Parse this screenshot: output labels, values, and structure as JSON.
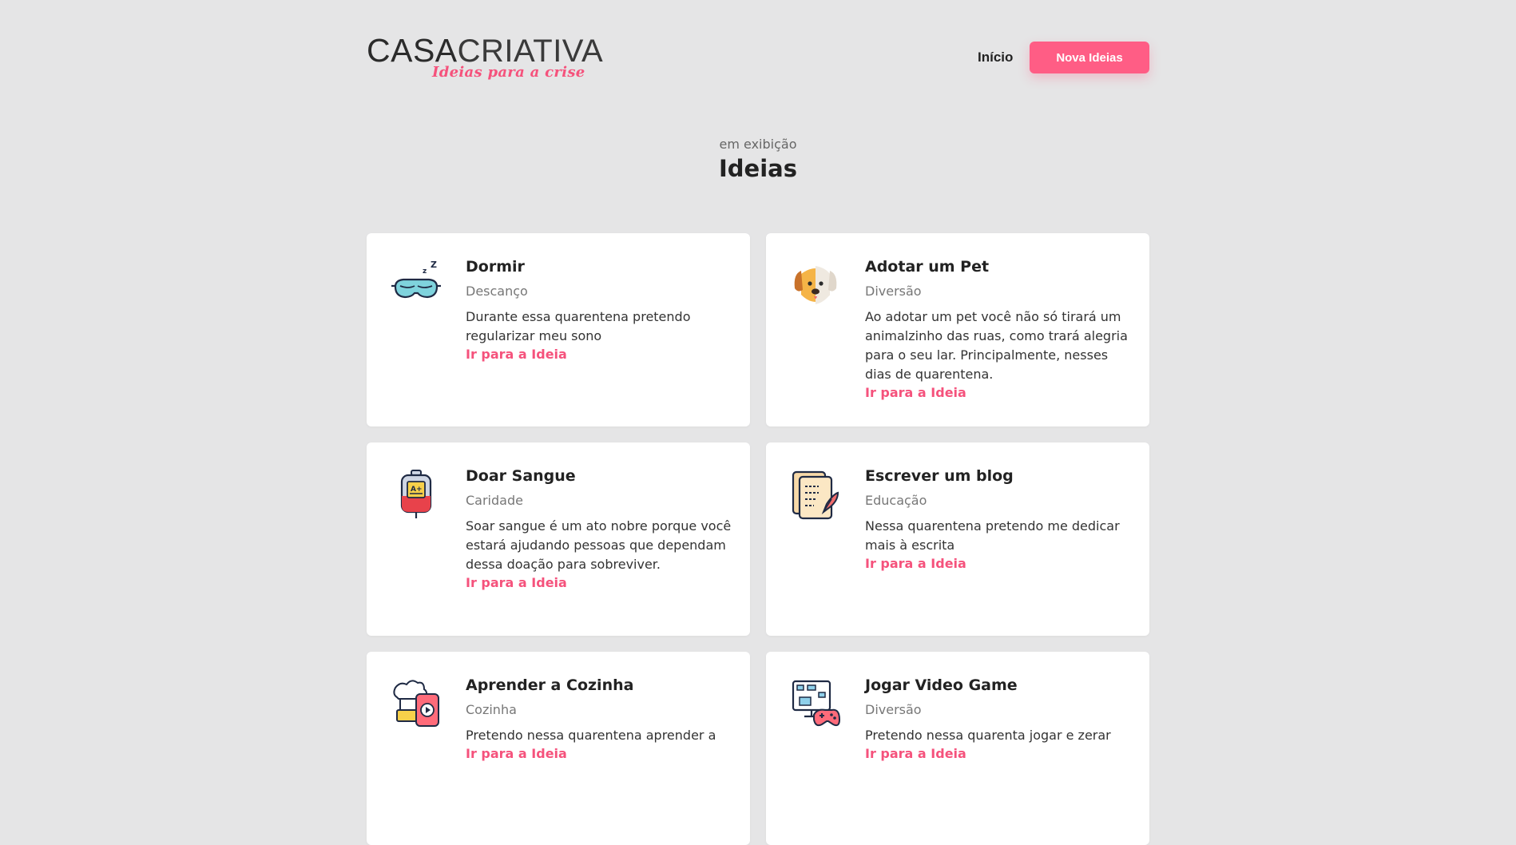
{
  "header": {
    "logo": {
      "part1": "CASA",
      "part2": "CRIATIVA",
      "tagline": "Ideias para a crise"
    },
    "nav_home": "Início",
    "cta_label": "Nova Ideias"
  },
  "section": {
    "overline": "em exibição",
    "title": "Ideias"
  },
  "ideas": [
    {
      "icon": "sleep-mask-icon",
      "title": "Dormir",
      "category": "Descanço",
      "description": "Durante essa quarentena pretendo regularizar meu sono",
      "link": "Ir para a Ideia"
    },
    {
      "icon": "dog-icon",
      "title": "Adotar um Pet",
      "category": "Diversão",
      "description": "Ao adotar um pet você não só tirará um animalzinho das ruas, como trará alegria para o seu lar. Principalmente, nesses dias de quarentena.",
      "link": "Ir para a Ideia"
    },
    {
      "icon": "blood-bag-icon",
      "title": "Doar Sangue",
      "category": "Caridade",
      "description": "Soar sangue é um ato nobre porque você estará ajudando pessoas que dependam dessa doação para sobreviver.",
      "link": "Ir para a Ideia"
    },
    {
      "icon": "writing-paper-icon",
      "title": "Escrever um blog",
      "category": "Educação",
      "description": "Nessa quarentena pretendo me dedicar mais à escrita",
      "link": "Ir para a Ideia"
    },
    {
      "icon": "cooking-video-icon",
      "title": "Aprender a Cozinha",
      "category": "Cozinha",
      "description": "Pretendo nessa quarentena aprender a",
      "link": "Ir para a Ideia"
    },
    {
      "icon": "video-game-icon",
      "title": "Jogar Video Game",
      "category": "Diversão",
      "description": "Pretendo nessa quarenta jogar e zerar",
      "link": "Ir para a Ideia"
    }
  ],
  "colors": {
    "accent": "#ff5d85",
    "background": "#e5e5e6",
    "card": "#ffffff"
  }
}
